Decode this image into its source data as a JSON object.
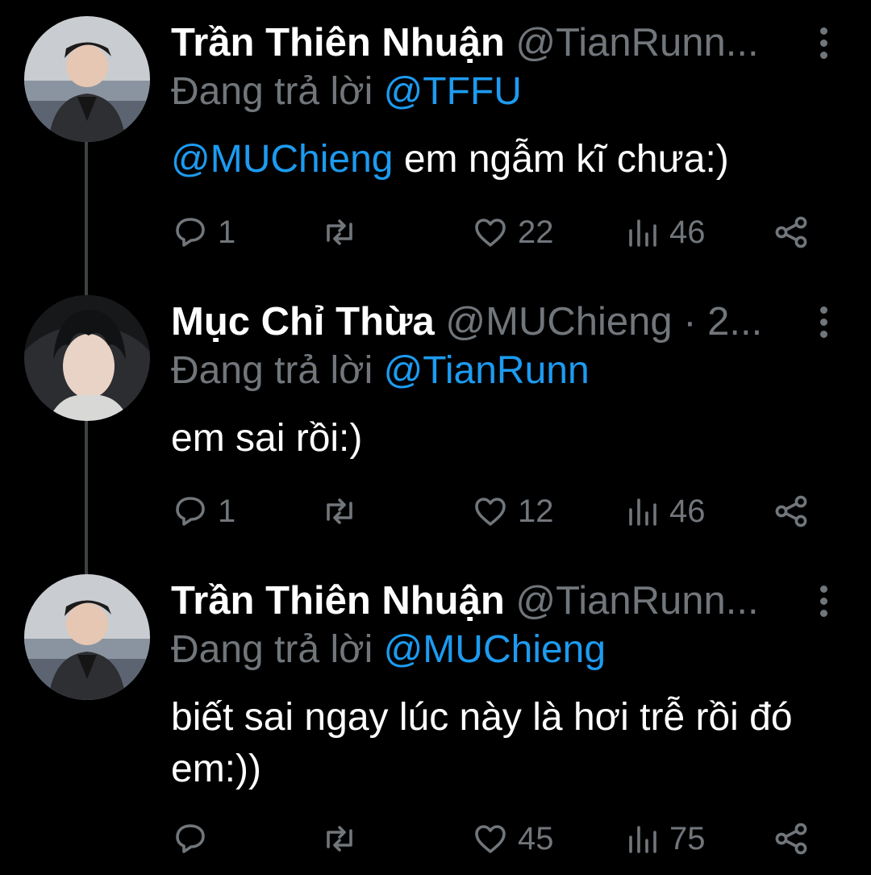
{
  "tweets": [
    {
      "name": "Trần Thiên Nhuận",
      "handle": "@TianRunn...",
      "replying_prefix": "Đang trả lời ",
      "replying_to": "@TFFU",
      "mention": "@MUChieng",
      "text": " em ngẫm kĩ chưa:)",
      "replies": "1",
      "likes": "22",
      "views": "46"
    },
    {
      "name": "Mục Chỉ Thừa",
      "handle": "@MUChieng · 2...",
      "replying_prefix": "Đang trả lời ",
      "replying_to": "@TianRunn",
      "text": "em sai rồi:)",
      "replies": "1",
      "likes": "12",
      "views": "46"
    },
    {
      "name": "Trần Thiên Nhuận",
      "handle": "@TianRunn...",
      "replying_prefix": "Đang trả lời ",
      "replying_to": "@MUChieng",
      "text": "biết sai ngay lúc này là hơi trễ rồi đó em:))",
      "replies": "",
      "likes": "45",
      "views": "75"
    }
  ],
  "icons": {
    "more": "more-vertical-icon",
    "reply": "reply-icon",
    "retweet": "retweet-icon",
    "like": "heart-icon",
    "views": "views-chart-icon",
    "share": "share-icon"
  },
  "colors": {
    "background": "#000000",
    "text": "#ffffff",
    "secondary": "#71767b",
    "link": "#1d9bf0",
    "thread_line": "#3e4144"
  }
}
